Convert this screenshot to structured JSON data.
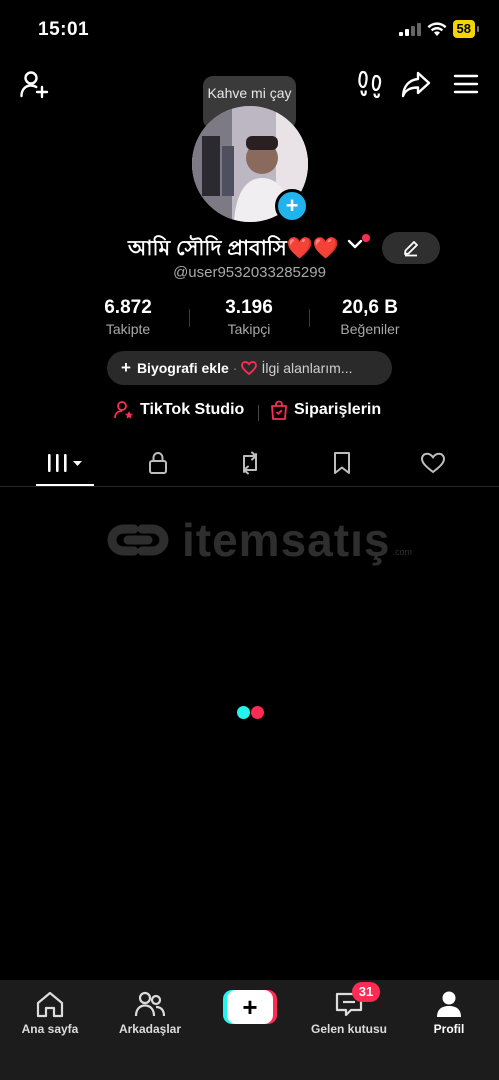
{
  "status_bar": {
    "time": "15:01",
    "battery": "58"
  },
  "tooltip": {
    "text": "Kahve mi çay mı?"
  },
  "profile": {
    "display_name": "আমি সৌদি প্রাবাসি❤️❤️",
    "username": "@user9532033285299"
  },
  "stats": [
    {
      "value": "6.872",
      "label": "Takipte"
    },
    {
      "value": "3.196",
      "label": "Takipçi"
    },
    {
      "value": "20,6 B",
      "label": "Beğeniler"
    }
  ],
  "bio_bar": {
    "add_bio": "Biyografi ekle",
    "separator": "·",
    "interests": "İlgi alanlarım..."
  },
  "links": {
    "studio": "TikTok Studio",
    "orders": "Siparişlerin"
  },
  "tabs": [
    "videos-grid",
    "private",
    "reposts",
    "favorites",
    "liked"
  ],
  "watermark": {
    "text": "itemsatış",
    "sub": ".com"
  },
  "bottom_nav": [
    {
      "label": "Ana sayfa",
      "icon": "home-icon"
    },
    {
      "label": "Arkadaşlar",
      "icon": "friends-icon"
    },
    {
      "label": "",
      "icon": "create-icon"
    },
    {
      "label": "Gelen kutusu",
      "icon": "inbox-icon",
      "badge": "31"
    },
    {
      "label": "Profil",
      "icon": "profile-icon"
    }
  ],
  "colors": {
    "accent_red": "#fe2c55",
    "accent_cyan": "#25f4ee",
    "plus_blue": "#21b3eb",
    "battery": "#f5d400"
  }
}
